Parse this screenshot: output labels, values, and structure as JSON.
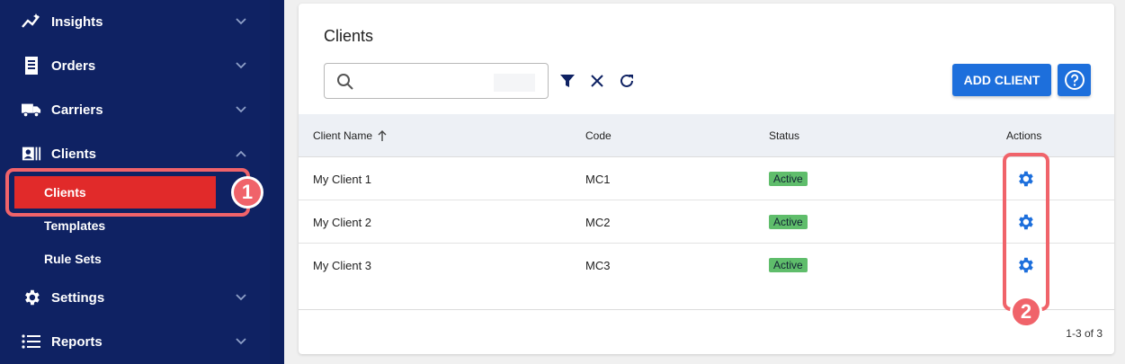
{
  "sidebar": {
    "items": [
      {
        "label": "Insights",
        "icon": "insights-icon"
      },
      {
        "label": "Orders",
        "icon": "receipt-icon"
      },
      {
        "label": "Carriers",
        "icon": "truck-icon"
      },
      {
        "label": "Clients",
        "icon": "contact-card-icon"
      },
      {
        "label": "Settings",
        "icon": "gear-icon"
      },
      {
        "label": "Reports",
        "icon": "list-icon"
      }
    ],
    "sub_items": [
      {
        "label": "Clients"
      },
      {
        "label": "Templates"
      },
      {
        "label": "Rule Sets"
      }
    ]
  },
  "callouts": {
    "one": "1",
    "two": "2"
  },
  "main": {
    "title": "Clients",
    "search": {
      "placeholder": ""
    },
    "add_button": "ADD CLIENT",
    "table": {
      "headers": {
        "name": "Client Name",
        "code": "Code",
        "status": "Status",
        "actions": "Actions"
      },
      "rows": [
        {
          "name": "My Client 1",
          "code": "MC1",
          "status": "Active"
        },
        {
          "name": "My Client 2",
          "code": "MC2",
          "status": "Active"
        },
        {
          "name": "My Client 3",
          "code": "MC3",
          "status": "Active"
        }
      ]
    },
    "pagination": "1-3 of 3"
  },
  "colors": {
    "sidebar": "#0f2263",
    "active": "#e12a2a",
    "accent": "#1d6fdc",
    "callout": "#f0636a",
    "status_active": "#5fbd6b"
  }
}
